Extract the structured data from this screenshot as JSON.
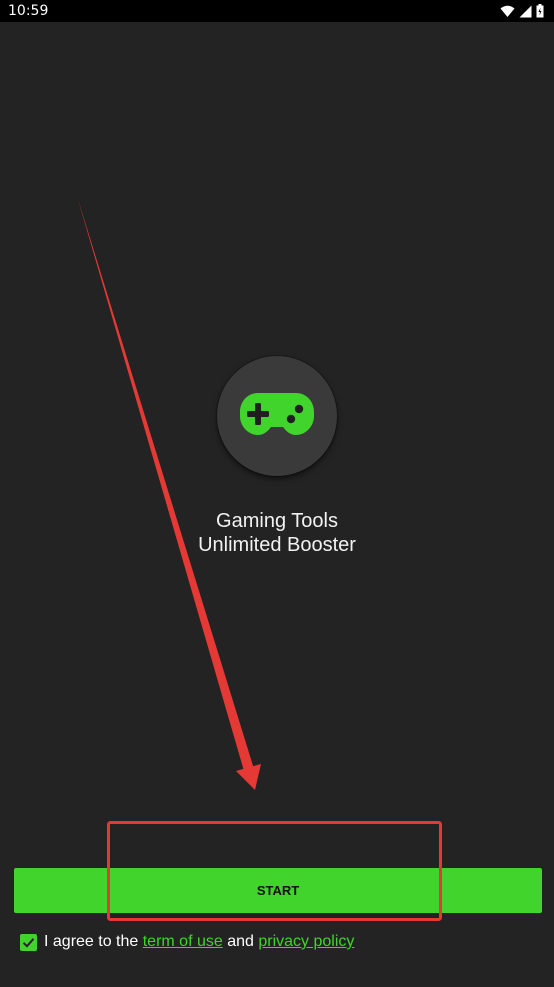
{
  "status_bar": {
    "time": "10:59",
    "icons": [
      "wifi-icon",
      "signal-icon",
      "battery-icon"
    ]
  },
  "app": {
    "logo_icon": "gamepad-icon",
    "title_line1": "Gaming Tools",
    "title_line2": "Unlimited Booster"
  },
  "start_button": {
    "label": "START"
  },
  "agreement": {
    "checked": true,
    "prefix": "I agree to the ",
    "terms_link": "term of use",
    "conjunction": " and ",
    "privacy_link": "privacy policy"
  },
  "colors": {
    "background": "#232323",
    "accent": "#40d42c",
    "annotation": "#e53935"
  }
}
